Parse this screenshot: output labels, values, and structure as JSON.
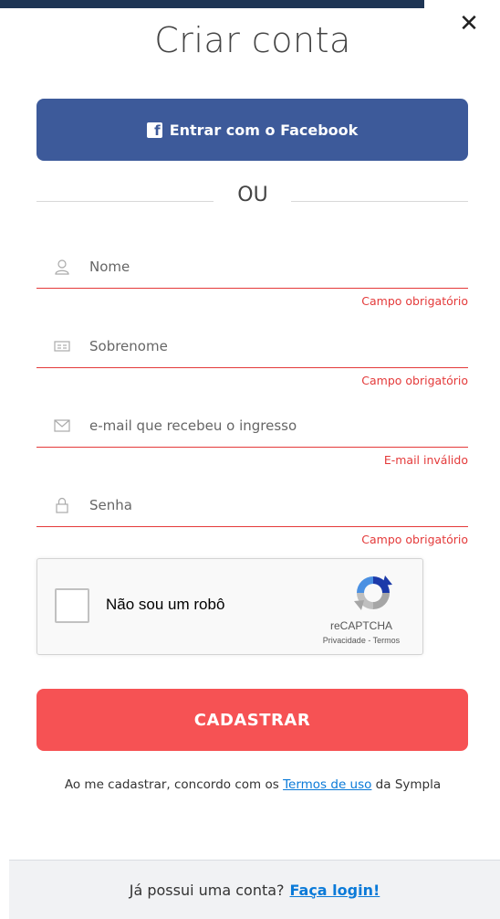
{
  "header": {
    "title": "Criar conta",
    "close_symbol": "✕"
  },
  "facebook": {
    "label": "Entrar com o Facebook",
    "icon_letter": "f",
    "icon": "facebook-icon",
    "color": "#3d5a9a"
  },
  "divider": {
    "text": "OU"
  },
  "form": {
    "fields": [
      {
        "placeholder": "Nome",
        "value": "",
        "icon": "user-icon",
        "error": "Campo obrigatório"
      },
      {
        "placeholder": "Sobrenome",
        "value": "",
        "icon": "id-card-icon",
        "error": "Campo obrigatório"
      },
      {
        "placeholder": "e-mail que recebeu o ingresso",
        "value": "",
        "icon": "envelope-icon",
        "error": "E-mail inválido"
      },
      {
        "placeholder": "Senha",
        "value": "",
        "icon": "lock-icon",
        "error": "Campo obrigatório"
      }
    ],
    "error_color": "#e43a3a"
  },
  "captcha": {
    "label": "Não sou um robô",
    "brand": "reCAPTCHA",
    "privacy": "Privacidade",
    "separator": " - ",
    "terms": "Termos",
    "icon": "recaptcha-icon"
  },
  "submit": {
    "label": "CADASTRAR",
    "color": "#f65254"
  },
  "terms": {
    "prefix": "Ao me cadastrar, concordo com os ",
    "link": "Termos de uso",
    "suffix": " da Sympla"
  },
  "footer": {
    "prompt": "Já possui uma conta?",
    "link": "Faça login!"
  }
}
